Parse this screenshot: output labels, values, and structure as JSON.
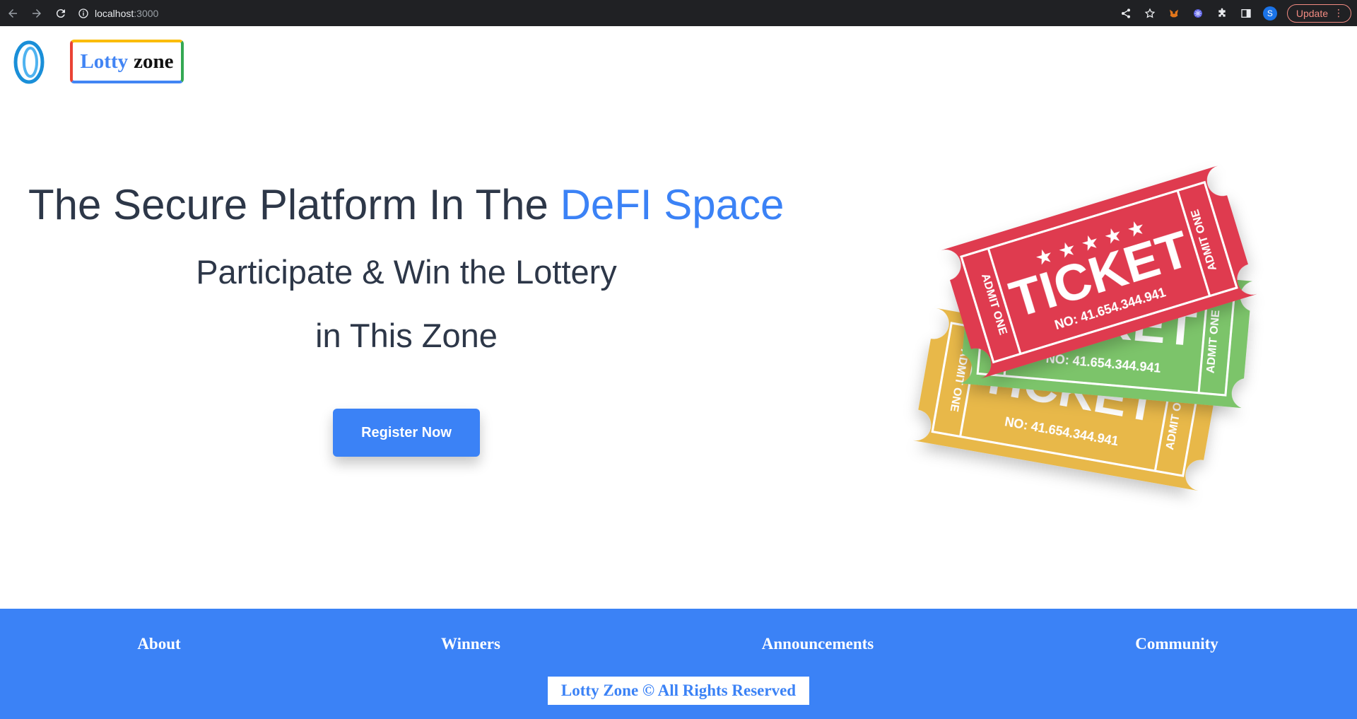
{
  "browser": {
    "url_host": "localhost",
    "url_port": ":3000",
    "profile_initial": "S",
    "update_label": "Update"
  },
  "header": {
    "brand_part1": "Lotty",
    "brand_part2": "zone"
  },
  "hero": {
    "title_main": "The Secure Platform In The ",
    "title_accent": "DeFI Space",
    "subtitle_line1": "Participate & Win the Lottery",
    "subtitle_line2": "in This Zone",
    "register_label": "Register Now"
  },
  "tickets": [
    {
      "color": "#e8b84a",
      "label": "TICKET",
      "number": "NO: 41.654.344.941",
      "side_text": "ADMIT ONE"
    },
    {
      "color": "#7cc46a",
      "label": "TICKET",
      "number": "NO: 41.654.344.941",
      "side_text": "ADMIT ONE"
    },
    {
      "color": "#df3a4f",
      "label": "TICKET",
      "number": "NO: 41.654.344.941",
      "side_text": "ADMIT ONE"
    }
  ],
  "footer": {
    "links": [
      "About",
      "Winners",
      "Announcements",
      "Community"
    ],
    "copyright": "Lotty Zone © All Rights Reserved"
  },
  "colors": {
    "accent": "#3b82f6",
    "text": "#2d3748"
  }
}
